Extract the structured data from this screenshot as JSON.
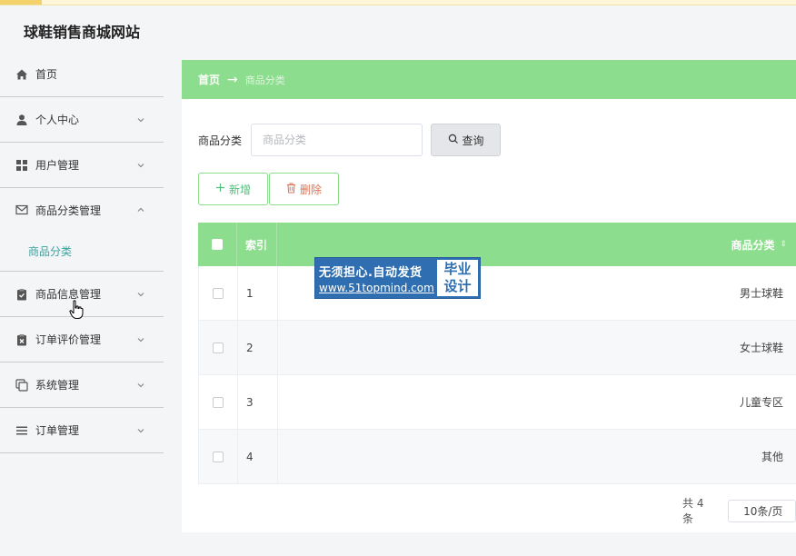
{
  "app": {
    "title": "球鞋销售商城网站"
  },
  "colors": {
    "accent": "#8ddd8e",
    "active_text": "#3aa3a0",
    "delete": "#e0704f"
  },
  "sidebar": {
    "items": [
      {
        "label": "首页",
        "icon": "home-icon"
      },
      {
        "label": "个人中心",
        "icon": "user-icon",
        "expandable": true
      },
      {
        "label": "用户管理",
        "icon": "grid-icon",
        "expandable": true
      },
      {
        "label": "商品分类管理",
        "icon": "envelope-icon",
        "expanded": true,
        "children": [
          {
            "label": "商品分类",
            "active": true
          }
        ]
      },
      {
        "label": "商品信息管理",
        "icon": "clipboard-check-icon",
        "expandable": true
      },
      {
        "label": "订单评价管理",
        "icon": "clipboard-x-icon",
        "expandable": true
      },
      {
        "label": "系统管理",
        "icon": "copy-icon",
        "expandable": true
      },
      {
        "label": "订单管理",
        "icon": "menu-lines-icon",
        "expandable": true
      }
    ]
  },
  "breadcrumb": {
    "home": "首页",
    "separator": "→",
    "current": "商品分类"
  },
  "search": {
    "label": "商品分类",
    "placeholder": "商品分类",
    "button_label": "查询"
  },
  "actions": {
    "add_label": "新增",
    "delete_label": "删除"
  },
  "table": {
    "headers": {
      "index": "索引",
      "category": "商品分类"
    },
    "rows": [
      {
        "index": "1",
        "category": "男士球鞋"
      },
      {
        "index": "2",
        "category": "女士球鞋"
      },
      {
        "index": "3",
        "category": "儿童专区"
      },
      {
        "index": "4",
        "category": "其他"
      }
    ]
  },
  "pagination": {
    "total": "共 4 条",
    "page_size": "10条/页"
  },
  "watermark": {
    "line1": "无须担心.自动发货",
    "line2": "www.51topmind.com",
    "badge_line1": "毕业",
    "badge_line2": "设计"
  }
}
